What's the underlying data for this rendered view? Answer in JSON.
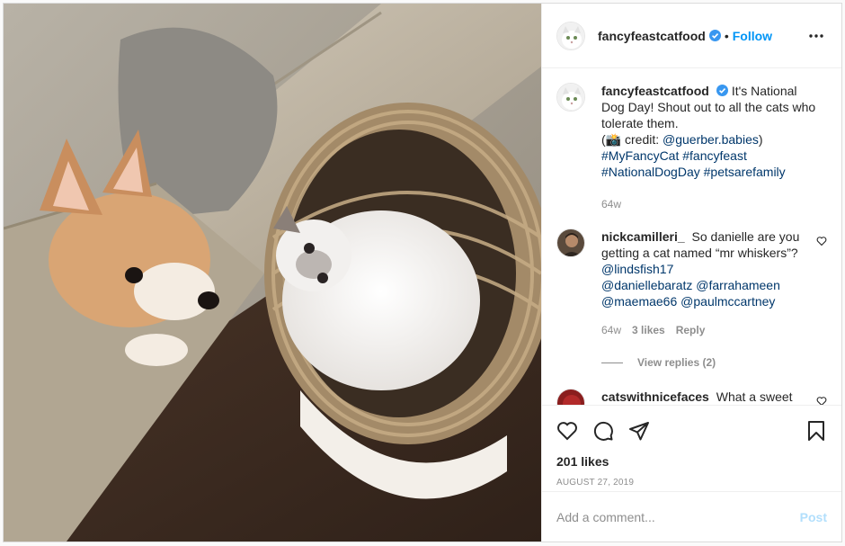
{
  "header": {
    "username": "fancyfeastcatfood",
    "separator": "•",
    "follow_label": "Follow",
    "verified_icon": "verified-badge-icon",
    "more_icon": "more-options-icon"
  },
  "caption": {
    "username": "fancyfeastcatfood",
    "text_1": "It's National Dog Day! Shout out to all the cats who tolerate them.",
    "credit_open": "(",
    "credit_emoji": "📸",
    "credit_label": " credit: ",
    "credit_user": "@guerber.babies",
    "credit_close": ")",
    "hashtags_1": "#MyFancyCat #fancyfeast",
    "hashtags_2": "#NationalDogDay #petsarefamily",
    "time": "64w"
  },
  "comments": [
    {
      "username": "nickcamilleri_",
      "text_1": "So danielle are you getting a cat named “mr whiskers”? ",
      "mention_1": "@lindsfish17",
      "mention_2": "@daniellebaratz",
      "mention_3": "@farrahameen",
      "mention_4": "@maemae66",
      "mention_5": "@paulmccartney",
      "time": "64w",
      "likes": "3 likes",
      "reply": "Reply",
      "view_replies": "View replies (2)"
    },
    {
      "username": "catswithnicefaces",
      "text": "What a sweet"
    }
  ],
  "actions": {
    "likes": "201 likes",
    "date": "AUGUST 27, 2019",
    "like_icon": "heart-icon",
    "comment_icon": "comment-icon",
    "share_icon": "share-icon",
    "save_icon": "bookmark-icon"
  },
  "add_comment": {
    "placeholder": "Add a comment...",
    "post_label": "Post"
  },
  "colors": {
    "link": "#00376b",
    "follow": "#0095f6",
    "post_disabled": "#b2dffc",
    "secondary": "#8e8e8e"
  }
}
